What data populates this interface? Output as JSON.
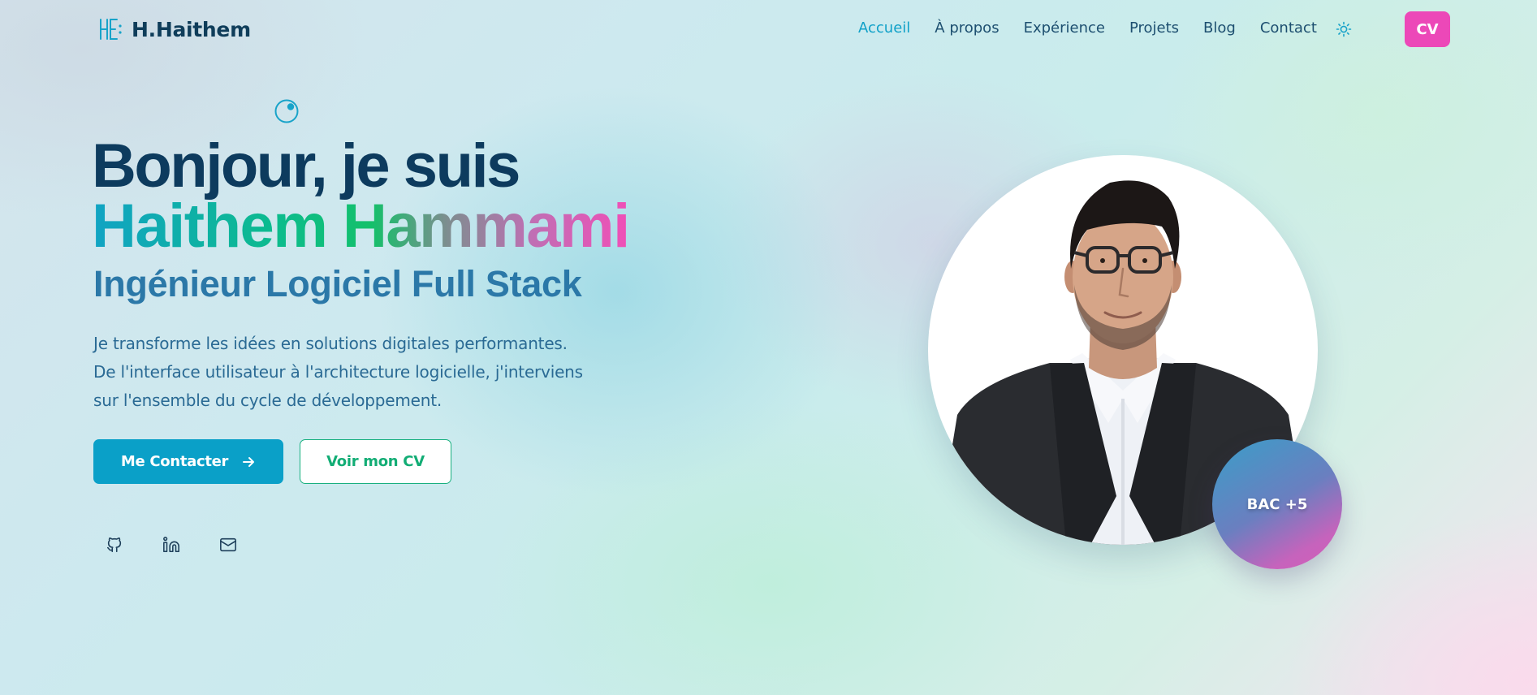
{
  "brand": {
    "logo_text": "H.Haithem",
    "accent_color": "#0fa0c8",
    "primary_text_color": "#0d3b5e",
    "cv_button_color": "#ec48b8"
  },
  "nav": {
    "items": [
      {
        "label": "Accueil",
        "active": true
      },
      {
        "label": "À propos",
        "active": false
      },
      {
        "label": "Expérience",
        "active": false
      },
      {
        "label": "Projets",
        "active": false
      },
      {
        "label": "Blog",
        "active": false
      },
      {
        "label": "Contact",
        "active": false
      }
    ],
    "theme_toggle_icon": "sun-icon",
    "cv_label": "CV"
  },
  "hero": {
    "greeting": "Bonjour, je suis",
    "name": "Haithem Hammami",
    "role": "Ingénieur Logiciel Full Stack",
    "description_lines": [
      "Je transforme les idées en solutions digitales performantes.",
      "De l'interface utilisateur à l'architecture logicielle, j'interviens",
      "sur l'ensemble du cycle de développement."
    ],
    "primary_button": {
      "label": "Me Contacter",
      "icon": "arrow-right-icon"
    },
    "secondary_button": {
      "label": "Voir mon CV"
    },
    "socials": [
      {
        "name": "github",
        "icon": "github-icon"
      },
      {
        "name": "linkedin",
        "icon": "linkedin-icon"
      },
      {
        "name": "email",
        "icon": "mail-icon"
      }
    ]
  },
  "profile": {
    "badge_text": "BAC +5"
  }
}
